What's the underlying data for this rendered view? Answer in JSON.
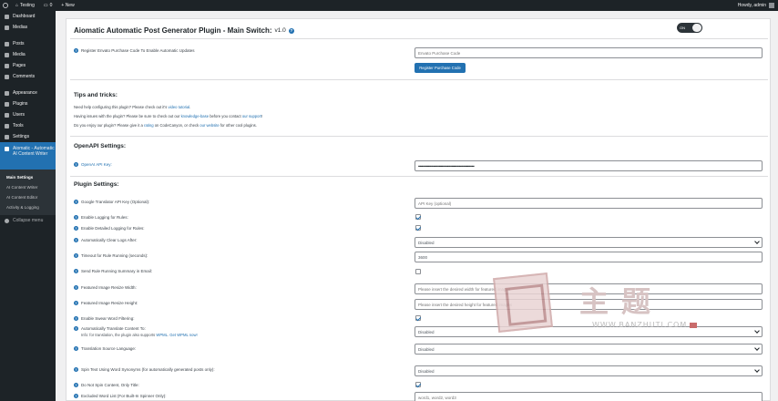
{
  "adminbar": {
    "site_name": "Testing",
    "comments_count": "0",
    "new_label": "+ New",
    "howdy": "Howdy, admin"
  },
  "sidebar": {
    "items": [
      {
        "label": "Dashboard",
        "icon": "dashboard-icon"
      },
      {
        "label": "Medias",
        "icon": "medias-icon"
      },
      {
        "label": "Posts",
        "icon": "posts-icon"
      },
      {
        "label": "Media",
        "icon": "media-icon"
      },
      {
        "label": "Pages",
        "icon": "pages-icon"
      },
      {
        "label": "Comments",
        "icon": "comments-icon"
      },
      {
        "label": "Appearance",
        "icon": "appearance-icon"
      },
      {
        "label": "Plugins",
        "icon": "plugins-icon"
      },
      {
        "label": "Users",
        "icon": "users-icon"
      },
      {
        "label": "Tools",
        "icon": "tools-icon"
      },
      {
        "label": "Settings",
        "icon": "settings-icon"
      }
    ],
    "active_label": "Aiomatic - Automatic AI Content Writer",
    "submenu": [
      "Main Settings",
      "AI Content Writer",
      "AI Content Editor",
      "Activity & Logging"
    ],
    "collapse_label": "Collapse menu"
  },
  "header": {
    "title": "Aiomatic Automatic Post Generator Plugin - Main Switch:",
    "version": "v1.0",
    "switch_label": "ON"
  },
  "license": {
    "label": "Register Envato Purchase Code To Enable Automatic Updates",
    "placeholder": "Envato Purchase Code",
    "button": "Register Purchase Code"
  },
  "tips": {
    "heading": "Tips and tricks:",
    "line1_pre": "Need help configuring this plugin? Please check out it's ",
    "line1_link": "video tutorial",
    "line1_post": ".",
    "line2_pre": "Having issues with the plugin? Please be sure to check out our ",
    "line2_link1": "knowledge-base",
    "line2_mid": " before you contact ",
    "line2_link2": "our support",
    "line2_post": "!",
    "line3_pre": "Do you enjoy our plugin? Please give it a ",
    "line3_link1": "rating",
    "line3_mid": " on CodeCanyon, or check ",
    "line3_link2": "our website",
    "line3_post": " for other cool plugins."
  },
  "openai": {
    "heading": "OpenAPI Settings:",
    "api_key_label": "OpenAI API Key:",
    "api_key_value": "•••••••••••••••••••••••••••••••••••••••••••••••••••••••••"
  },
  "plugin": {
    "heading": "Plugin Settings:",
    "translator_label": "Google Translator API Key (Optional):",
    "translator_placeholder": "API Key (optional)",
    "logging_label": "Enable Logging for Rules:",
    "detailed_label": "Enable Detailed Logging for Rules:",
    "clear_logs_label": "Automatically Clear Logs After:",
    "clear_logs_value": "Disabled",
    "timeout_label": "Timeout for Rule Running (seconds):",
    "timeout_value": "3600",
    "email_label": "Send Rule Running Summary in Email:",
    "resize_width_label": "Featured Image Resize Width:",
    "resize_width_placeholder": "Please insert the desired width for featured images",
    "resize_height_label": "Featured Image Resize Height:",
    "resize_height_placeholder": "Please insert the desired height for featured images",
    "swear_label": "Enable Swear Word Filtering:",
    "translate_label": "Automatically Translate Content To:",
    "translate_note_pre": "Info: for translation, the plugin also supports ",
    "translate_note_link1": "WPML",
    "translate_note_mid": ". ",
    "translate_note_link2": "Get WPML now!",
    "translate_value": "Disabled",
    "source_lang_label": "Translation Source Language:",
    "source_lang_value": "Disabled",
    "spin_label": "Spin Text Using Word Synonyms (for automatically generated posts only):",
    "spin_value": "Disabled",
    "spin_title_label": "Do Not Spin Content, Only Title:",
    "excluded_label": "Excluded Word List (For Built-In Spinner Only):",
    "excluded_placeholder": "word1, word2, word3"
  },
  "watermark": {
    "cn_text": "主题",
    "url_text": "WWW.BANZHUTI.COM"
  }
}
